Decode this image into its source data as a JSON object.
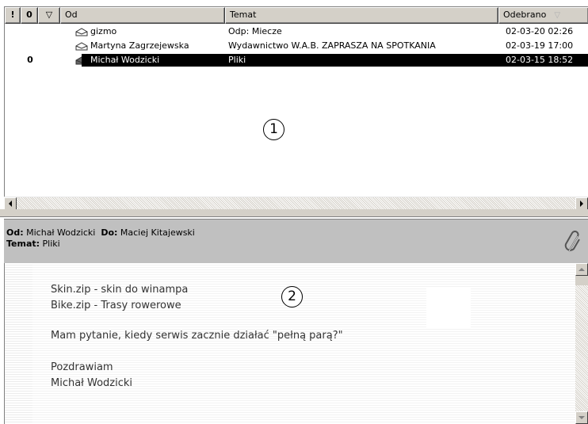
{
  "columns": {
    "priority": "!",
    "attachment": "0",
    "flag": "▽",
    "from": "Od",
    "subject": "Temat",
    "received": "Odebrano",
    "sort_indicator": "▽"
  },
  "messages": [
    {
      "from": "gizmo",
      "subject": "Odp: Miecze",
      "received": "02-03-20 02:26",
      "attachment": "",
      "read": true,
      "selected": false
    },
    {
      "from": "Martyna Zagrzejewska",
      "subject": "Wydawnictwo W.A.B. ZAPRASZA NA SPOTKANIA",
      "received": "02-03-19 17:00",
      "attachment": "",
      "read": true,
      "selected": false
    },
    {
      "from": "Michał Wodzicki",
      "subject": "Pliki",
      "received": "02-03-15 18:52",
      "attachment": "0",
      "read": true,
      "selected": true
    }
  ],
  "markers": {
    "list": "1",
    "preview": "2"
  },
  "preview": {
    "from_label": "Od:",
    "from_value": "Michał Wodzicki",
    "to_label": "Do:",
    "to_value": "Maciej Kitajewski",
    "subject_label": "Temat:",
    "subject_value": "Pliki",
    "body_lines": [
      "Skin.zip - skin do winampa",
      "Bike.zip - Trasy rowerowe",
      "",
      "Mam pytanie, kiedy serwis zacznie działać \"pełną parą?\"",
      "",
      "Pozdrawiam",
      "Michał Wodzicki"
    ]
  },
  "colors": {
    "selection": "#000000",
    "chrome": "#d4d0c8",
    "preview_header": "#c0c0c0"
  },
  "icons": {
    "envelope": "envelope-open-icon",
    "attachment": "paperclip-icon"
  }
}
